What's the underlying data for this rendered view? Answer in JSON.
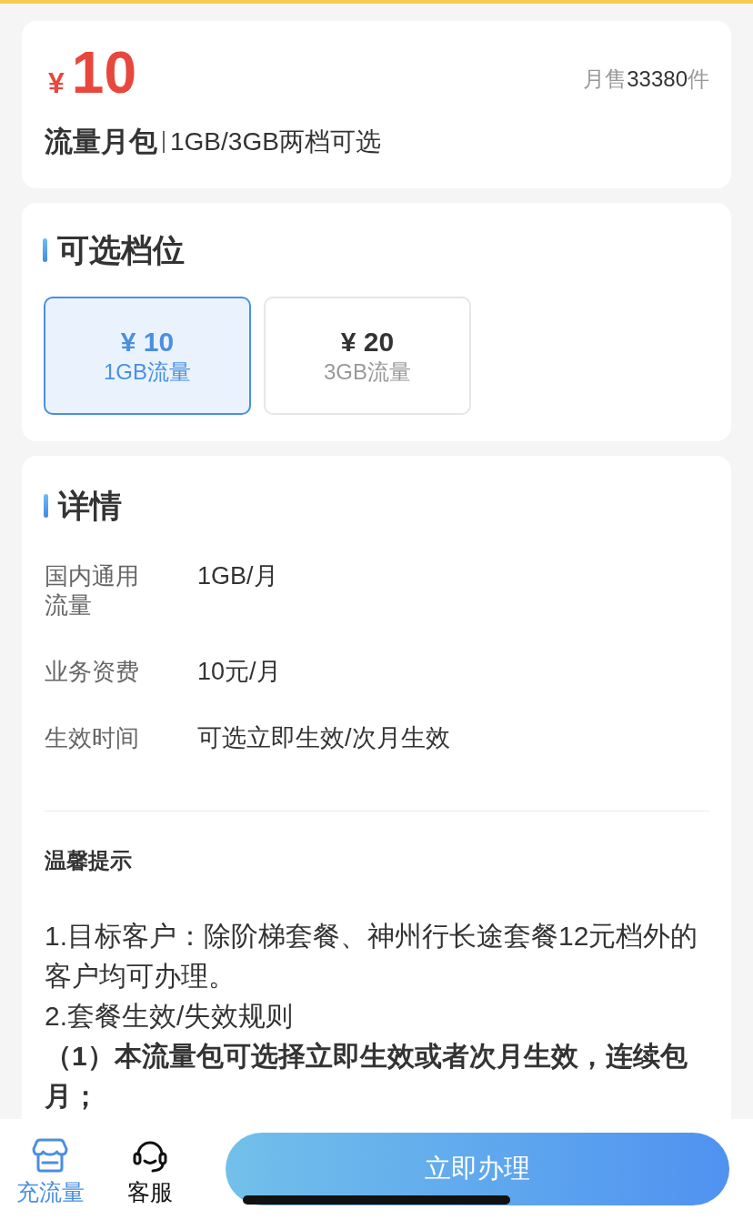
{
  "product": {
    "currency": "¥",
    "price": "10",
    "sales": {
      "prefix": "月售",
      "count": "33380",
      "unit": "件"
    },
    "title": "流量月包",
    "subtitle": "1GB/3GB两档可选"
  },
  "tiers": {
    "title": "可选档位",
    "options": [
      {
        "price": "¥ 10",
        "label": "1GB流量",
        "selected": true
      },
      {
        "price": "¥ 20",
        "label": "3GB流量",
        "selected": false
      }
    ]
  },
  "details": {
    "title": "详情",
    "rows": [
      {
        "label": "国内通用流量",
        "value": "1GB/月"
      },
      {
        "label": "业务资费",
        "value": "10元/月"
      },
      {
        "label": "生效时间",
        "value": "可选立即生效/次月生效"
      }
    ],
    "notice": {
      "title": "温馨提示",
      "paragraphs": [
        {
          "text": "1.目标客户：除阶梯套餐、神州行长途套餐12元档外的客户均可办理。",
          "bold": false
        },
        {
          "text": "2.套餐生效/失效规则",
          "bold": false
        },
        {
          "text": "（1）本流量包可选择立即生效或者次月生效，连续包月；",
          "bold": true
        }
      ]
    }
  },
  "bottom_bar": {
    "tabs": [
      {
        "label": "充流量",
        "selected": true
      },
      {
        "label": "客服",
        "selected": false
      }
    ],
    "action": "立即办理"
  }
}
